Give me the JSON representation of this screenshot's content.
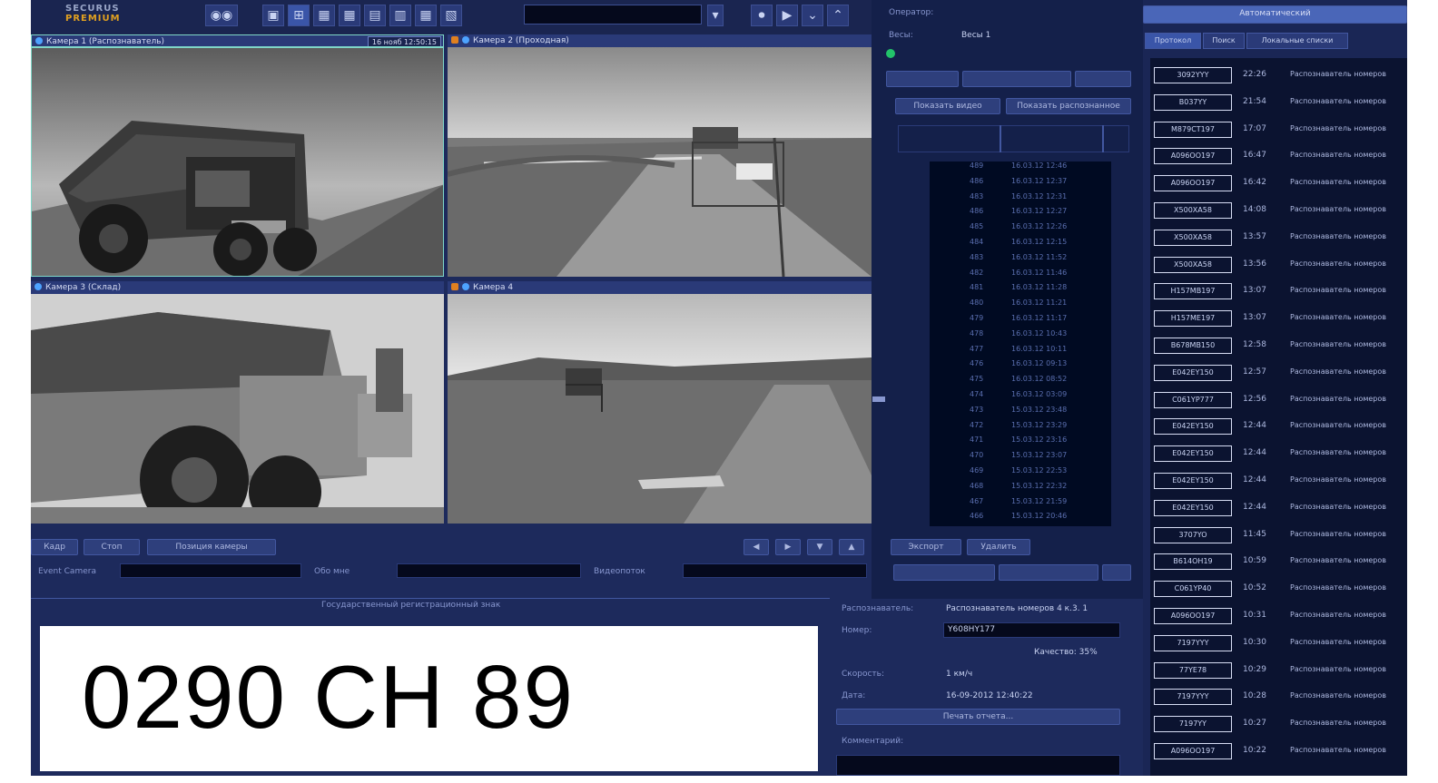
{
  "app": {
    "logo_top": "SECURUS",
    "logo_bottom": "PREMIUM"
  },
  "cameras": [
    {
      "title": "Камера 1 (Распознаватель)",
      "timestamp": "16 нояб 12:50:15"
    },
    {
      "title": "Камера 2 (Проходная)"
    },
    {
      "title": "Камера 3 (Склад)"
    },
    {
      "title": "Камера 4"
    }
  ],
  "video_controls": {
    "buttons": [
      "Кадр",
      "Стоп",
      "Позиция камеры"
    ],
    "labels": [
      "Event Camera",
      "Обо мне",
      "Видеопоток"
    ]
  },
  "operator": {
    "operator_label": "Оператор:",
    "scales_label": "Весы:",
    "scales_value": "Весы 1"
  },
  "middle_buttons": [
    "Показать видео",
    "Показать распознанное"
  ],
  "middle_bottom_buttons": [
    "Экспорт",
    "Удалить"
  ],
  "records": [
    {
      "id": "489",
      "time": "16.03.12 12:46"
    },
    {
      "id": "486",
      "time": "16.03.12 12:37"
    },
    {
      "id": "483",
      "time": "16.03.12 12:31"
    },
    {
      "id": "486",
      "time": "16.03.12 12:27"
    },
    {
      "id": "485",
      "time": "16.03.12 12:26"
    },
    {
      "id": "484",
      "time": "16.03.12 12:15"
    },
    {
      "id": "483",
      "time": "16.03.12 11:52"
    },
    {
      "id": "482",
      "time": "16.03.12 11:46"
    },
    {
      "id": "481",
      "time": "16.03.12 11:28"
    },
    {
      "id": "480",
      "time": "16.03.12 11:21"
    },
    {
      "id": "479",
      "time": "16.03.12 11:17"
    },
    {
      "id": "478",
      "time": "16.03.12 10:43"
    },
    {
      "id": "477",
      "time": "16.03.12 10:11"
    },
    {
      "id": "476",
      "time": "16.03.12 09:13"
    },
    {
      "id": "475",
      "time": "16.03.12 08:52"
    },
    {
      "id": "474",
      "time": "16.03.12 03:09"
    },
    {
      "id": "473",
      "time": "15.03.12 23:48"
    },
    {
      "id": "472",
      "time": "15.03.12 23:29"
    },
    {
      "id": "471",
      "time": "15.03.12 23:16"
    },
    {
      "id": "470",
      "time": "15.03.12 23:07"
    },
    {
      "id": "469",
      "time": "15.03.12 22:53"
    },
    {
      "id": "468",
      "time": "15.03.12 22:32"
    },
    {
      "id": "467",
      "time": "15.03.12 21:59"
    },
    {
      "id": "466",
      "time": "15.03.12 20:46"
    }
  ],
  "plate_section": {
    "header": "Государственный регистрационный знак",
    "plate_text": "0290 CH 89"
  },
  "details": {
    "recognizer_label": "Распознаватель:",
    "recognizer_value": "Распознаватель номеров 4 к.3. 1",
    "number_label": "Номер:",
    "number_value": "Y608HY177",
    "quality": "Качество: 35%",
    "speed_label": "Скорость:",
    "speed_value": "1 км/ч",
    "date_label": "Дата:",
    "date_value": "16-09-2012 12:40:22",
    "print_button": "Печать отчета...",
    "comment_label": "Комментарий:"
  },
  "right_panel": {
    "header_button": "Автоматический",
    "tabs": [
      "Протокол",
      "Поиск",
      "Локальные списки"
    ],
    "log": [
      {
        "plate": "3092YYY",
        "time": "22:26",
        "recognizer": "Распознаватель номеров"
      },
      {
        "plate": "B037YY",
        "time": "21:54",
        "recognizer": "Распознаватель номеров"
      },
      {
        "plate": "M879CT197",
        "time": "17:07",
        "recognizer": "Распознаватель номеров"
      },
      {
        "plate": "A096OO197",
        "time": "16:47",
        "recognizer": "Распознаватель номеров"
      },
      {
        "plate": "A096OO197",
        "time": "16:42",
        "recognizer": "Распознаватель номеров"
      },
      {
        "plate": "X500XA58",
        "time": "14:08",
        "recognizer": "Распознаватель номеров"
      },
      {
        "plate": "X500XA58",
        "time": "13:57",
        "recognizer": "Распознаватель номеров"
      },
      {
        "plate": "X500XA58",
        "time": "13:56",
        "recognizer": "Распознаватель номеров"
      },
      {
        "plate": "H157MB197",
        "time": "13:07",
        "recognizer": "Распознаватель номеров"
      },
      {
        "plate": "H157ME197",
        "time": "13:07",
        "recognizer": "Распознаватель номеров"
      },
      {
        "plate": "B678MB150",
        "time": "12:58",
        "recognizer": "Распознаватель номеров"
      },
      {
        "plate": "E042EY150",
        "time": "12:57",
        "recognizer": "Распознаватель номеров"
      },
      {
        "plate": "C061YP777",
        "time": "12:56",
        "recognizer": "Распознаватель номеров"
      },
      {
        "plate": "E042EY150",
        "time": "12:44",
        "recognizer": "Распознаватель номеров"
      },
      {
        "plate": "E042EY150",
        "time": "12:44",
        "recognizer": "Распознаватель номеров"
      },
      {
        "plate": "E042EY150",
        "time": "12:44",
        "recognizer": "Распознаватель номеров"
      },
      {
        "plate": "E042EY150",
        "time": "12:44",
        "recognizer": "Распознаватель номеров"
      },
      {
        "plate": "3707YO",
        "time": "11:45",
        "recognizer": "Распознаватель номеров"
      },
      {
        "plate": "B614OH19",
        "time": "10:59",
        "recognizer": "Распознаватель номеров"
      },
      {
        "plate": "C061YP40",
        "time": "10:52",
        "recognizer": "Распознаватель номеров"
      },
      {
        "plate": "A096OO197",
        "time": "10:31",
        "recognizer": "Распознаватель номеров"
      },
      {
        "plate": "7197YYY",
        "time": "10:30",
        "recognizer": "Распознаватель номеров"
      },
      {
        "plate": "77YE78",
        "time": "10:29",
        "recognizer": "Распознаватель номеров"
      },
      {
        "plate": "7197YYY",
        "time": "10:28",
        "recognizer": "Распознаватель номеров"
      },
      {
        "plate": "7197YY",
        "time": "10:27",
        "recognizer": "Распознаватель номеров"
      },
      {
        "plate": "A096OO197",
        "time": "10:22",
        "recognizer": "Распознаватель номеров"
      }
    ]
  },
  "colors": {
    "background": "#1d2a5c",
    "panel": "#1a2655",
    "accent": "#2a3a78",
    "plate_bg": "#ffffff"
  }
}
